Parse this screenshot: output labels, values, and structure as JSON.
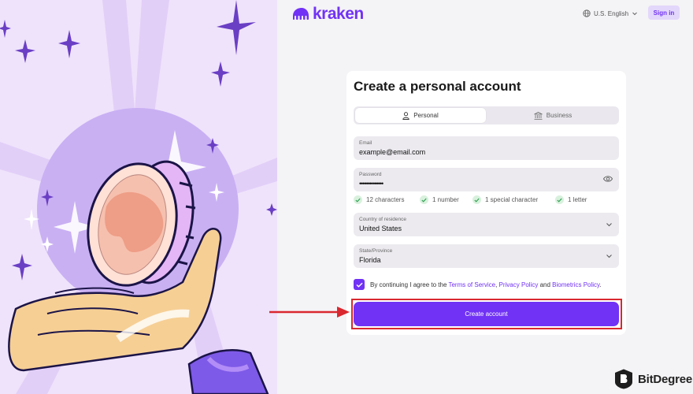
{
  "header": {
    "logo_text": "kraken",
    "language": "U.S. English",
    "signin_label": "Sign in"
  },
  "form": {
    "title": "Create a personal account",
    "tabs": [
      {
        "label": "Personal",
        "icon": "person-icon",
        "active": true
      },
      {
        "label": "Business",
        "icon": "bank-icon",
        "active": false
      }
    ],
    "email": {
      "label": "Email",
      "value": "example@email.com"
    },
    "password": {
      "label": "Password",
      "value": "••••••••••••••"
    },
    "requirements": [
      "12 characters",
      "1 number",
      "1 special character",
      "1 letter"
    ],
    "country": {
      "label": "Country of residence",
      "value": "United States"
    },
    "state": {
      "label": "State/Province",
      "value": "Florida"
    },
    "consent": {
      "prefix": "By continuing I agree to the",
      "terms": "Terms of Service",
      "sep1": ",",
      "privacy": "Privacy Policy",
      "and": "and",
      "biometrics": "Biometrics Policy",
      "end": ".",
      "checked": true
    },
    "submit_label": "Create account"
  },
  "watermark": {
    "text": "BitDegree"
  },
  "colors": {
    "accent": "#7132f5",
    "highlight_border": "#d9282f",
    "check_green": "#2e9e4f",
    "illustration_bg": "#efe3fb"
  }
}
